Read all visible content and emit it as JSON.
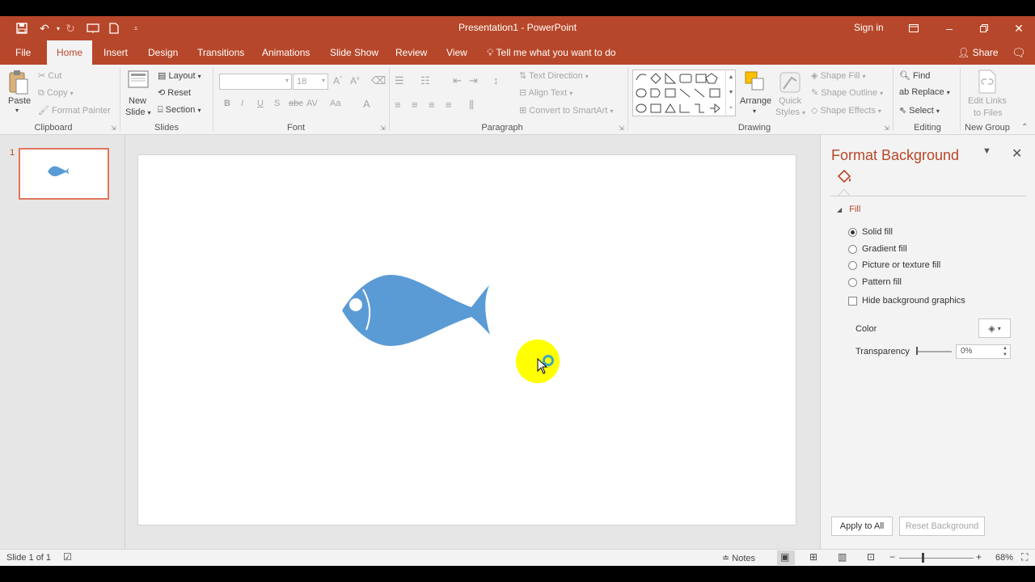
{
  "titlebar": {
    "title": "Presentation1  -  PowerPoint",
    "sign_in": "Sign in"
  },
  "tabs": [
    "File",
    "Home",
    "Insert",
    "Design",
    "Transitions",
    "Animations",
    "Slide Show",
    "Review",
    "View"
  ],
  "tell_me": "Tell me what you want to do",
  "share": "Share",
  "ribbon": {
    "clipboard": {
      "label": "Clipboard",
      "paste": "Paste",
      "cut": "Cut",
      "copy": "Copy",
      "format_painter": "Format Painter"
    },
    "slides": {
      "label": "Slides",
      "new_slide_1": "New",
      "new_slide_2": "Slide",
      "layout": "Layout",
      "reset": "Reset",
      "section": "Section"
    },
    "font": {
      "label": "Font",
      "size": "18"
    },
    "paragraph": {
      "label": "Paragraph",
      "text_direction": "Text Direction",
      "align_text": "Align Text",
      "convert_smartart": "Convert to SmartArt"
    },
    "drawing": {
      "label": "Drawing",
      "arrange": "Arrange",
      "quick_styles_1": "Quick",
      "quick_styles_2": "Styles",
      "shape_fill": "Shape Fill",
      "shape_outline": "Shape Outline",
      "shape_effects": "Shape Effects"
    },
    "editing": {
      "label": "Editing",
      "find": "Find",
      "replace": "Replace",
      "select": "Select"
    },
    "newgroup": {
      "label": "New Group",
      "edit_links_1": "Edit Links",
      "edit_links_2": "to Files"
    }
  },
  "thumbnail": {
    "number": "1"
  },
  "format_background": {
    "title": "Format Background",
    "fill_heading": "Fill",
    "options": [
      "Solid fill",
      "Gradient fill",
      "Picture or texture fill",
      "Pattern fill"
    ],
    "hide_graphics": "Hide background graphics",
    "color_label": "Color",
    "transparency_label": "Transparency",
    "transparency_value": "0%",
    "apply_all": "Apply to All",
    "reset_background": "Reset Background"
  },
  "status": {
    "slide_info": "Slide 1 of 1",
    "notes": "Notes",
    "zoom": "68%"
  },
  "colors": {
    "accent": "#b7472a",
    "fish": "#5b9bd5",
    "cursor_highlight": "#ffff00"
  }
}
